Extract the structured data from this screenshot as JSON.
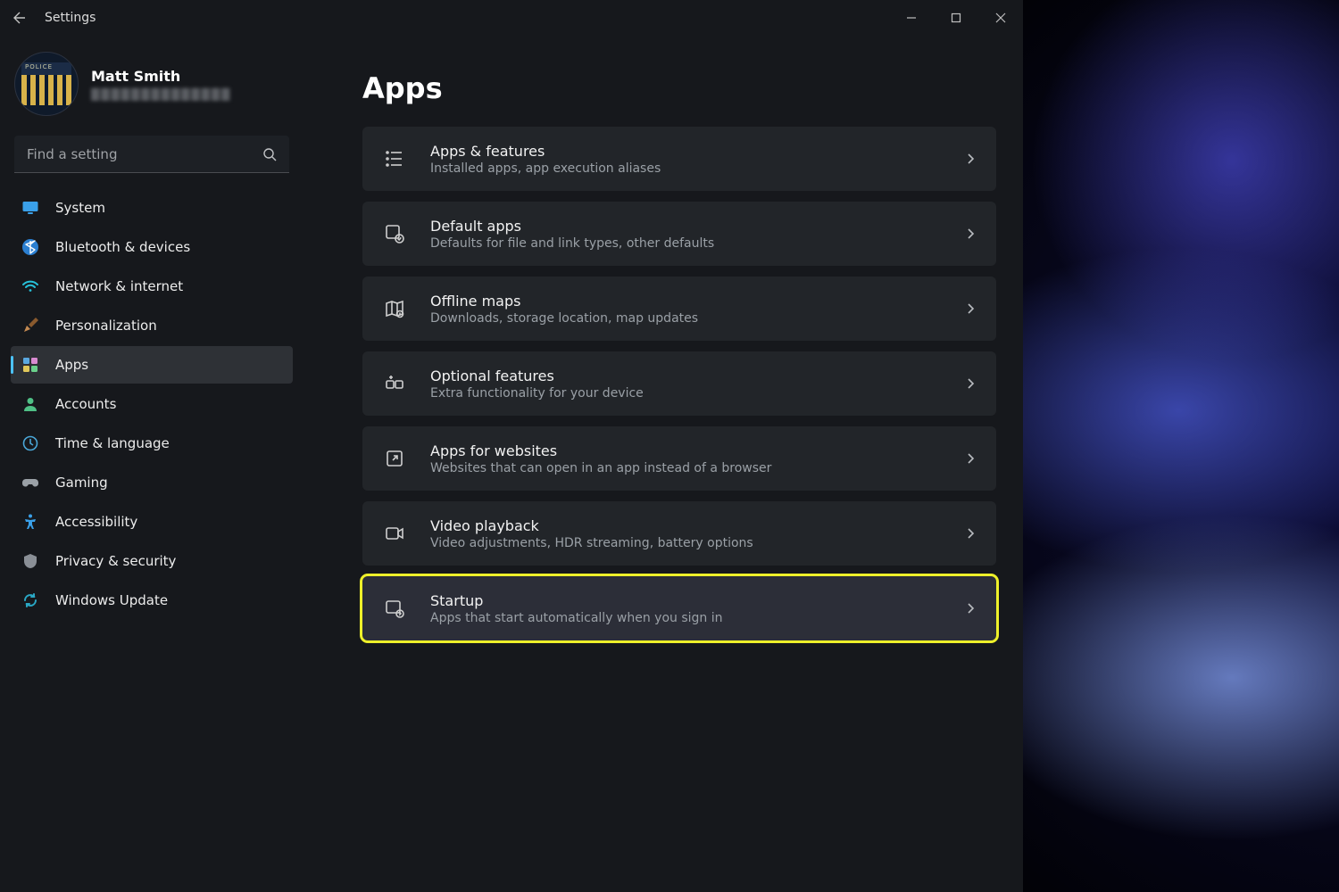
{
  "window_title": "Settings",
  "user": {
    "name": "Matt Smith",
    "email": "██████████████"
  },
  "search": {
    "placeholder": "Find a setting"
  },
  "sidebar": {
    "items": [
      {
        "label": "System"
      },
      {
        "label": "Bluetooth & devices"
      },
      {
        "label": "Network & internet"
      },
      {
        "label": "Personalization"
      },
      {
        "label": "Apps"
      },
      {
        "label": "Accounts"
      },
      {
        "label": "Time & language"
      },
      {
        "label": "Gaming"
      },
      {
        "label": "Accessibility"
      },
      {
        "label": "Privacy & security"
      },
      {
        "label": "Windows Update"
      }
    ],
    "active_index": 4
  },
  "page": {
    "title": "Apps",
    "rows": [
      {
        "title": "Apps & features",
        "subtitle": "Installed apps, app execution aliases"
      },
      {
        "title": "Default apps",
        "subtitle": "Defaults for file and link types, other defaults"
      },
      {
        "title": "Offline maps",
        "subtitle": "Downloads, storage location, map updates"
      },
      {
        "title": "Optional features",
        "subtitle": "Extra functionality for your device"
      },
      {
        "title": "Apps for websites",
        "subtitle": "Websites that can open in an app instead of a browser"
      },
      {
        "title": "Video playback",
        "subtitle": "Video adjustments, HDR streaming, battery options"
      },
      {
        "title": "Startup",
        "subtitle": "Apps that start automatically when you sign in"
      }
    ],
    "highlight_index": 6
  }
}
